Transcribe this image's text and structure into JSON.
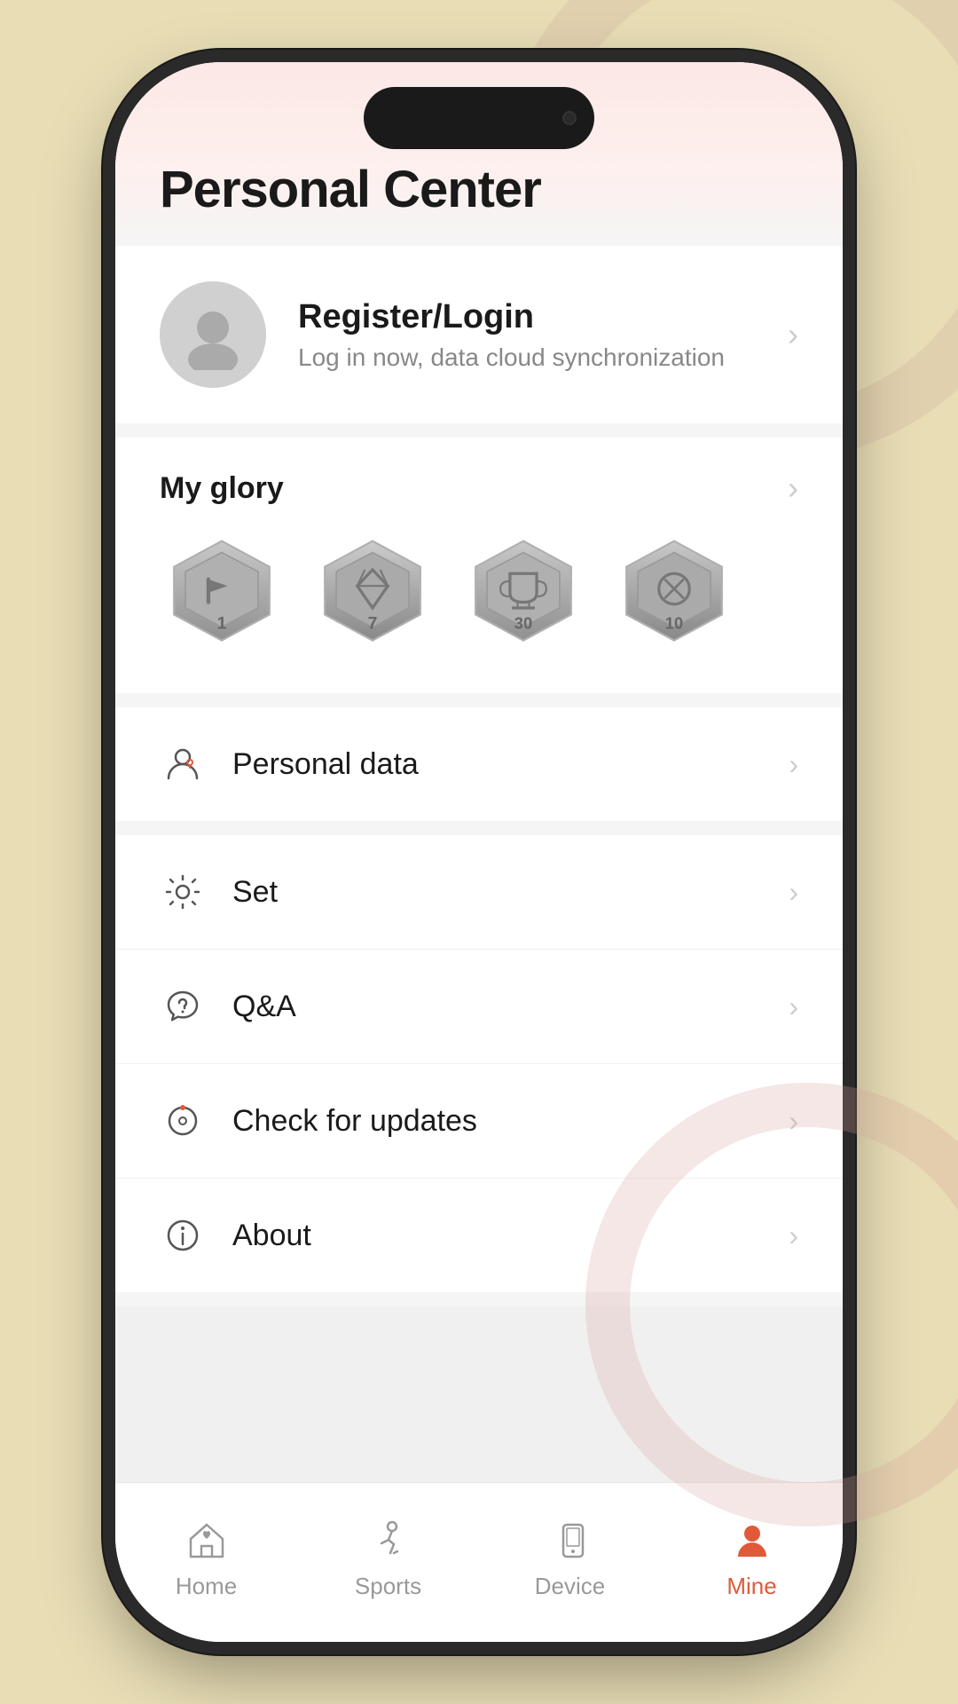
{
  "page": {
    "title": "Personal Center",
    "background_color": "#e8ddb5"
  },
  "profile": {
    "register_label": "Register/Login",
    "subtitle": "Log in now, data cloud synchronization"
  },
  "glory": {
    "title": "My glory",
    "badges": [
      {
        "id": 1,
        "number": "1"
      },
      {
        "id": 2,
        "number": "7"
      },
      {
        "id": 3,
        "number": "30"
      },
      {
        "id": 4,
        "number": "10"
      }
    ]
  },
  "menu": {
    "items": [
      {
        "id": "personal-data",
        "label": "Personal data"
      },
      {
        "id": "set",
        "label": "Set"
      },
      {
        "id": "qa",
        "label": "Q&A"
      },
      {
        "id": "check-updates",
        "label": "Check for updates"
      },
      {
        "id": "about",
        "label": "About"
      }
    ]
  },
  "tabs": {
    "items": [
      {
        "id": "home",
        "label": "Home",
        "active": false
      },
      {
        "id": "sports",
        "label": "Sports",
        "active": false
      },
      {
        "id": "device",
        "label": "Device",
        "active": false
      },
      {
        "id": "mine",
        "label": "Mine",
        "active": true
      }
    ]
  }
}
